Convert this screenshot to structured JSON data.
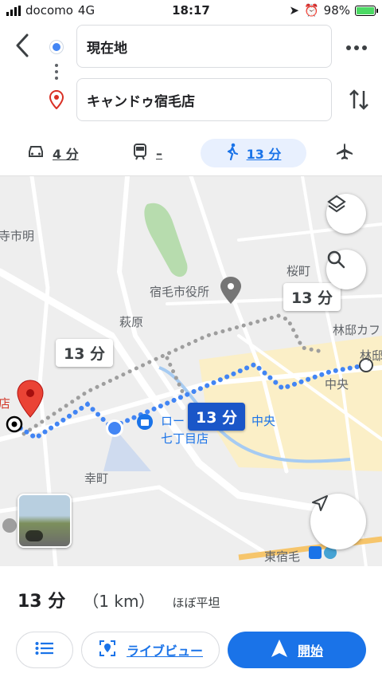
{
  "status_bar": {
    "carrier": "docomo",
    "network": "4G",
    "time": "18:17",
    "battery": "98%"
  },
  "route": {
    "origin": "現在地",
    "destination": "キャンドゥ宿毛店"
  },
  "modes": [
    {
      "icon": "car-icon",
      "label": "4 分",
      "selected": false
    },
    {
      "icon": "train-icon",
      "label": "–",
      "selected": false
    },
    {
      "icon": "walk-icon",
      "label": "13 分",
      "selected": true
    },
    {
      "icon": "flight-icon",
      "label": "",
      "selected": false
    }
  ],
  "map": {
    "labels": {
      "shi_mei": "寺市明",
      "city_hall": "宿毛市役所",
      "sakuramachi": "桜町",
      "hagiwara": "萩原",
      "rinyu_cafe": "林邸カフ",
      "rinyu_short": "林邸",
      "chuo": "中央",
      "store_fragment": "店",
      "lawson_1": "ロー",
      "lawson_chuo": "中央",
      "lawson_2": "七丁目店",
      "saiwaicho": "幸町",
      "higashi_sukumo": "東宿毛"
    },
    "duration_bubbles": {
      "alt_left": "13 分",
      "alt_right": "13 分",
      "selected": "13 分"
    },
    "colors": {
      "route": "#4285f4",
      "alt_route": "#9e9e9e",
      "highlight_area": "#fbefc7",
      "park": "#b7dcae"
    }
  },
  "summary": {
    "duration": "13 分",
    "distance": "（1 km）",
    "terrain": "ほぼ平坦"
  },
  "actions": {
    "live_view": "ライブビュー",
    "start": "開始"
  }
}
